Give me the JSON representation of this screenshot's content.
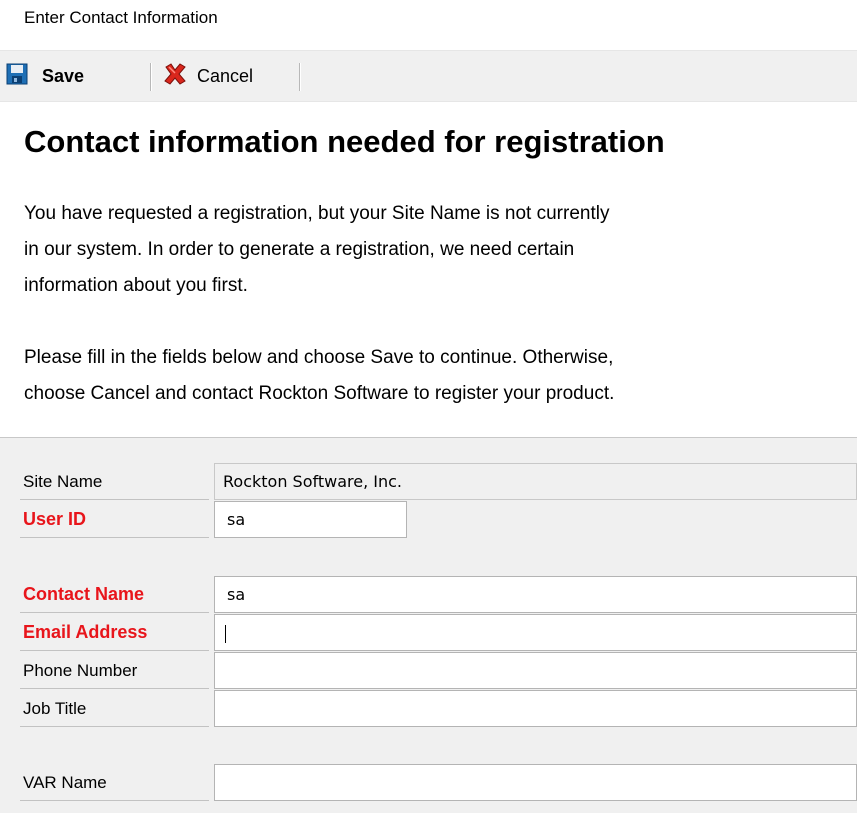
{
  "window": {
    "title": "Enter Contact Information"
  },
  "toolbar": {
    "save_label": "Save",
    "cancel_label": "Cancel"
  },
  "heading": "Contact information needed for registration",
  "paragraphs": {
    "p1_line1": "You have requested a registration, but your Site Name is not currently",
    "p1_line2": "in our system.  In order to generate a registration, we need certain",
    "p1_line3": "information about you first.",
    "p2_line1": "Please fill in the fields below and choose Save to continue.  Otherwise,",
    "p2_line2": "choose Cancel and contact Rockton Software to register your product."
  },
  "form": {
    "site_name": {
      "label": "Site Name",
      "value": "Rockton Software, Inc."
    },
    "user_id": {
      "label": "User ID",
      "value": "sa"
    },
    "contact_name": {
      "label": "Contact Name",
      "value": "sa"
    },
    "email_address": {
      "label": "Email Address",
      "value": ""
    },
    "phone_number": {
      "label": "Phone Number",
      "value": ""
    },
    "job_title": {
      "label": "Job Title",
      "value": ""
    },
    "var_name": {
      "label": "VAR Name",
      "value": ""
    }
  },
  "colors": {
    "required_label": "#e8151b",
    "toolbar_bg": "#f0f0f0",
    "form_bg": "#f0f0f0"
  },
  "icons": {
    "save": "floppy-disk-icon",
    "cancel": "red-x-icon"
  }
}
